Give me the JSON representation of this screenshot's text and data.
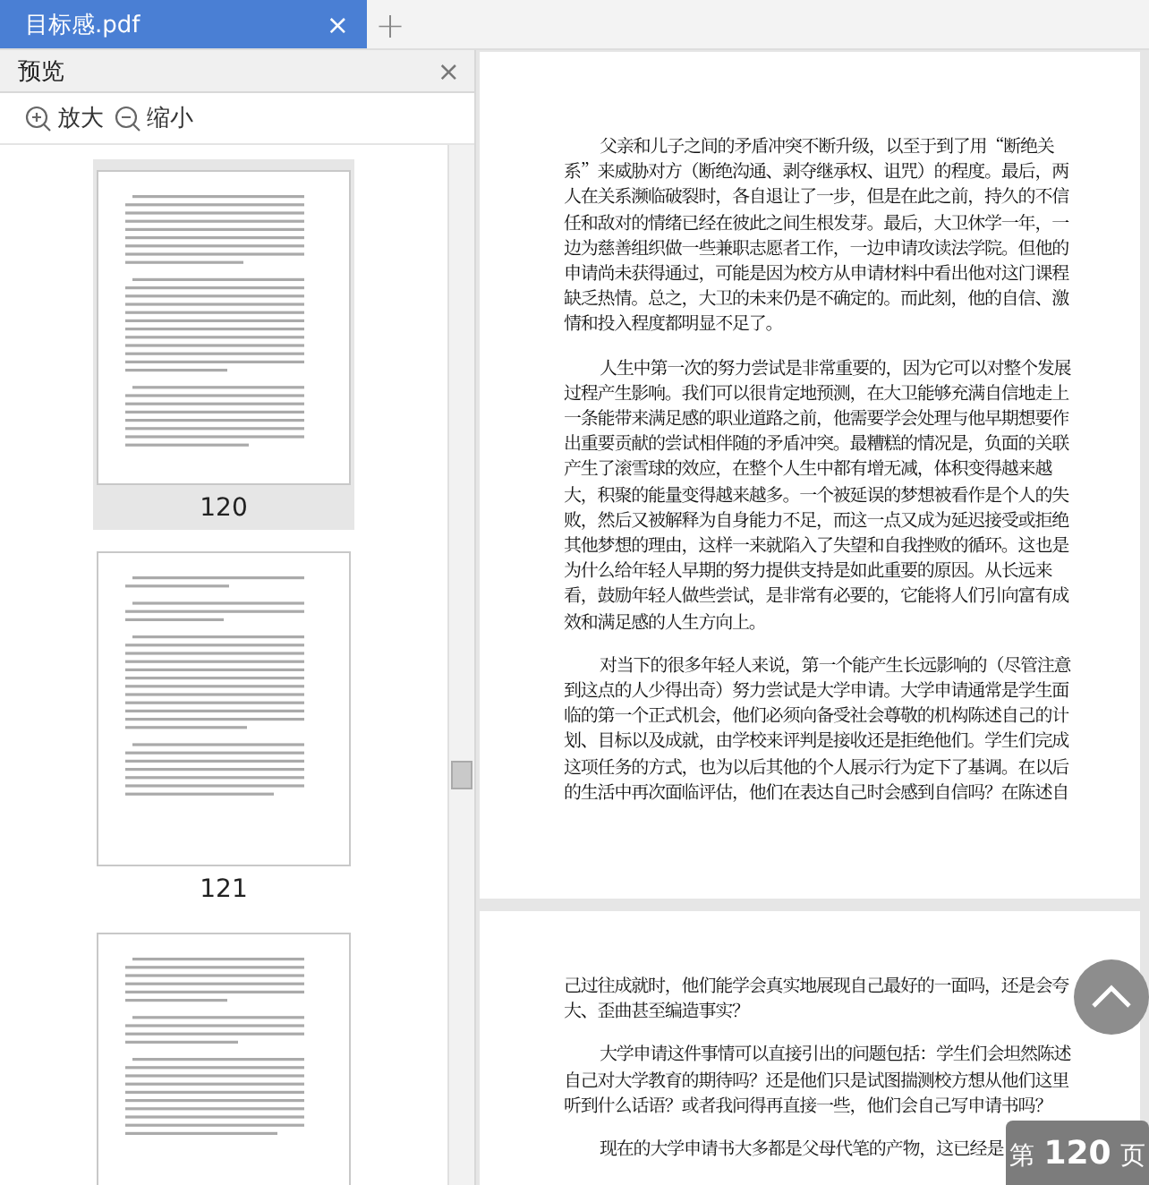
{
  "tab": {
    "title": "目标感.pdf",
    "close": "×",
    "new_tab": "+"
  },
  "preview_panel": {
    "title": "预览",
    "close": "×",
    "zoom_in": "放大",
    "zoom_out": "缩小",
    "thumbnails": [
      {
        "label": "120",
        "selected": true
      },
      {
        "label": "121",
        "selected": false
      },
      {
        "selected": false
      }
    ]
  },
  "document": {
    "pages": [
      {
        "paragraphs": [
          {
            "indent": true,
            "text": "父亲和儿子之间的矛盾冲突不断升级，以至于到了用“断绝关系”来威胁对方（断绝沟通、剥夺继承权、诅咒）的程度。最后，两人在关系濒临破裂时，各自退让了一步，但是在此之前，持久的不信任和敌对的情绪已经在彼此之间生根发芽。最后，大卫休学一年，一边为慈善组织做一些兼职志愿者工作，一边申请攻读法学院。但他的申请尚未获得通过，可能是因为校方从申请材料中看出他对这门课程缺乏热情。总之，大卫的未来仍是不确定的。而此刻，他的自信、激情和投入程度都明显不足了。"
          },
          {
            "indent": true,
            "text": "人生中第一次的努力尝试是非常重要的，因为它可以对整个发展过程产生影响。我们可以很肯定地预测，在大卫能够充满自信地走上一条能带来满足感的职业道路之前，他需要学会处理与他早期想要作出重要贡献的尝试相伴随的矛盾冲突。最糟糕的情况是，负面的关联产生了滚雪球的效应，在整个人生中都有增无减，体积变得越来越大，积聚的能量变得越来越多。一个被延误的梦想被看作是个人的失败，然后又被解释为自身能力不足，而这一点又成为延迟接受或拒绝其他梦想的理由，这样一来就陷入了失望和自我挫败的循环。这也是为什么给年轻人早期的努力提供支持是如此重要的原因。从长远来看，鼓励年轻人做些尝试，是非常有必要的，它能将人们引向富有成效和满足感的人生方向上。"
          },
          {
            "indent": true,
            "text": "对当下的很多年轻人来说，第一个能产生长远影响的（尽管注意到这点的人少得出奇）努力尝试是大学申请。大学申请通常是学生面临的第一个正式机会，他们必须向备受社会尊敬的机构陈述自己的计划、目标以及成就，由学校来评判是接收还是拒绝他们。学生们完成这项任务的方式，也为以后其他的个人展示行为定下了基调。在以后的生活中再次面临评估，他们在表达自己时会感到自信吗？在陈述自"
          }
        ]
      },
      {
        "paragraphs": [
          {
            "indent": false,
            "text": "己过往成就时，他们能学会真实地展现自己最好的一面吗，还是会夸大、歪曲甚至编造事实？"
          },
          {
            "indent": true,
            "text": "大学申请这件事情可以直接引出的问题包括：学生们会坦然陈述自己对大学教育的期待吗？还是他们只是试图揣测校方想从他们这里听到什么话语？或者我问得再直接一些，他们会自己写申请书吗？"
          },
          {
            "indent": true,
            "text": "现在的大学申请书大多都是父母代笔的产物，这已经是"
          }
        ]
      }
    ]
  },
  "page_indicator": "第 **120** 页"
}
